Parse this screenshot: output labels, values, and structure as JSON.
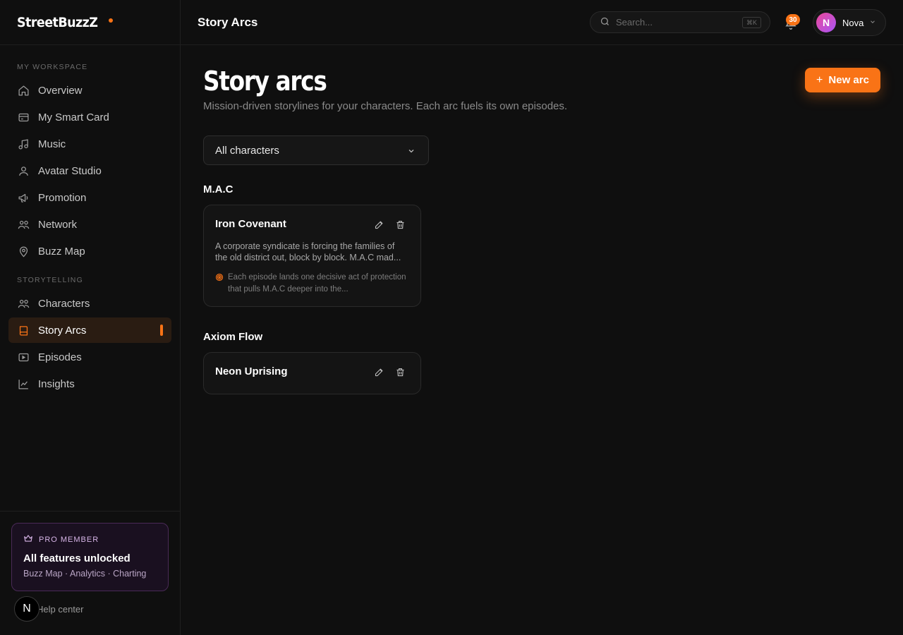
{
  "app": {
    "logo": "StreetBuzzZ",
    "page_header": "Story Arcs"
  },
  "search": {
    "placeholder": "Search...",
    "shortcut": "⌘K"
  },
  "notifications": {
    "count": "30"
  },
  "user": {
    "initial": "N",
    "name": "Nova"
  },
  "sidebar": {
    "workspace_title": "MY WORKSPACE",
    "workspace_items": [
      {
        "label": "Overview",
        "icon": "home-icon"
      },
      {
        "label": "My Smart Card",
        "icon": "card-icon"
      },
      {
        "label": "Music",
        "icon": "music-icon"
      },
      {
        "label": "Avatar Studio",
        "icon": "user-icon"
      },
      {
        "label": "Promotion",
        "icon": "megaphone-icon"
      },
      {
        "label": "Network",
        "icon": "users-icon"
      },
      {
        "label": "Buzz Map",
        "icon": "map-pin-icon"
      }
    ],
    "storytelling_title": "STORYTELLING",
    "storytelling_items": [
      {
        "label": "Characters",
        "icon": "users-icon"
      },
      {
        "label": "Story Arcs",
        "icon": "book-icon",
        "active": true
      },
      {
        "label": "Episodes",
        "icon": "video-icon"
      },
      {
        "label": "Insights",
        "icon": "chart-icon"
      }
    ],
    "pro": {
      "badge": "PRO MEMBER",
      "title": "All features unlocked",
      "features": "Buzz Map · Analytics · Charting"
    },
    "help": {
      "initial": "N",
      "label": "Help center"
    }
  },
  "main": {
    "title": "Story arcs",
    "subtitle": "Mission-driven storylines for your characters. Each arc fuels its own episodes.",
    "new_button": "New arc",
    "filter": {
      "selected": "All characters"
    },
    "groups": [
      {
        "name": "M.A.C",
        "arcs": [
          {
            "title": "Iron Covenant",
            "description": "A corporate syndicate is forcing the families of the old district out, block by block. M.A.C mad...",
            "goal": "Each episode lands one decisive act of protection that pulls M.A.C deeper into the..."
          }
        ]
      },
      {
        "name": "Axiom Flow",
        "arcs": [
          {
            "title": "Neon Uprising"
          }
        ]
      }
    ]
  },
  "colors": {
    "accent": "#f97316",
    "background": "#0f0f0f",
    "pro_border": "#4a2a57"
  }
}
